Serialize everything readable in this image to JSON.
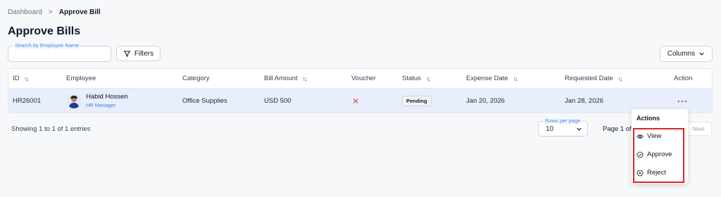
{
  "breadcrumb": {
    "root": "Dashboard",
    "separator": ">",
    "current": "Approve Bill"
  },
  "page_title": "Approve Bills",
  "search": {
    "label": "Search by Employee Name",
    "value": ""
  },
  "filters_label": "Filters",
  "columns_label": "Columns",
  "table": {
    "headers": {
      "id": "ID",
      "employee": "Employee",
      "category": "Category",
      "bill_amount": "Bill Amount",
      "voucher": "Voucher",
      "status": "Status",
      "expense_date": "Expense Date",
      "requested_date": "Requested Date",
      "action": "Action"
    },
    "rows": [
      {
        "id": "HR26001",
        "employee_name": "Habid Hossen",
        "employee_role": "HR Manager",
        "category": "Office Supplies",
        "bill_amount": "USD 500",
        "voucher": "✕",
        "status": "Pending",
        "expense_date": "Jan 20, 2026",
        "requested_date": "Jan 28, 2026",
        "action": "···"
      }
    ]
  },
  "footer": {
    "showing": "Showing 1 to 1 of 1 entries",
    "rows_per_page_label": "Rows per page",
    "rows_per_page_value": "10",
    "page_of": "Page 1 of",
    "next_label": "Next"
  },
  "actions_menu": {
    "title": "Actions",
    "items": [
      "View",
      "Approve",
      "Reject"
    ]
  },
  "colors": {
    "accent": "#3b82f6",
    "highlight_border": "#dc2626",
    "row_selected": "#e8eefb",
    "voucher_missing": "#ef4444"
  }
}
